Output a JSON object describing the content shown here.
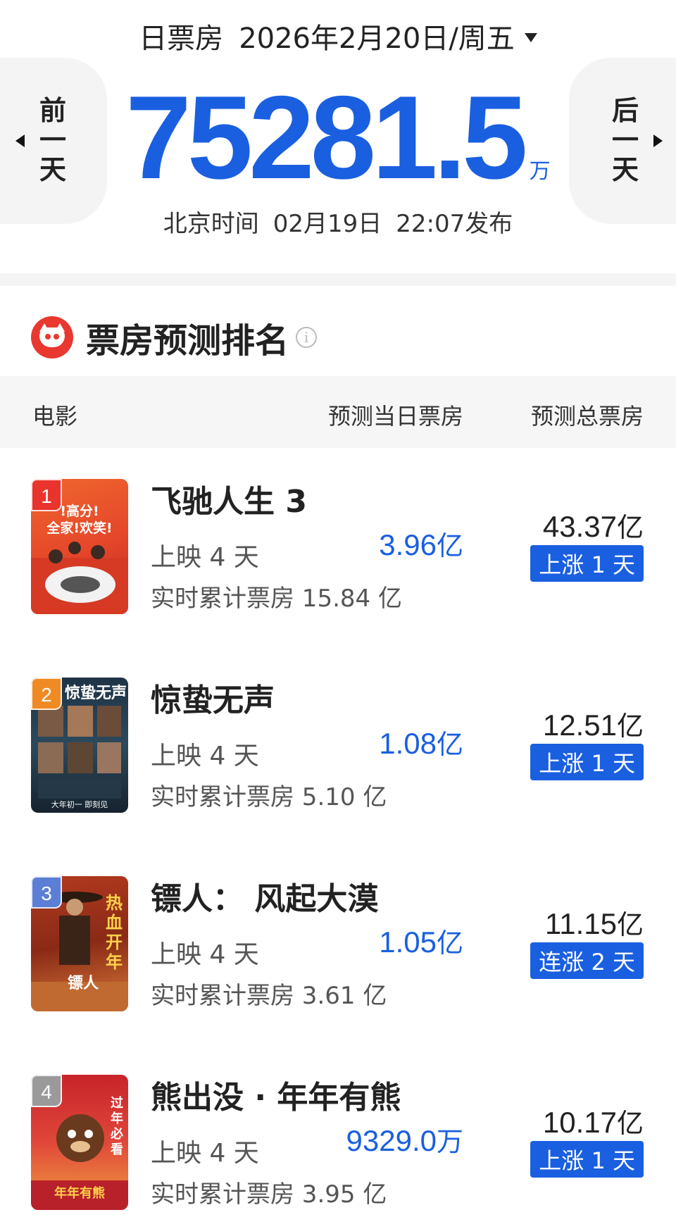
{
  "header": {
    "label": "日票房",
    "date": "2026年2月20日/周五",
    "prev_chars": [
      "前",
      "一",
      "天"
    ],
    "next_chars": [
      "后",
      "一",
      "天"
    ],
    "total": "75281.5",
    "total_unit": "万",
    "publish_prefix": "北京时间",
    "publish_date": "02月19日",
    "publish_time": "22:07发布"
  },
  "section": {
    "title": "票房预测排名",
    "info_glyph": "i"
  },
  "columns": {
    "movie": "电影",
    "day_pred": "预测当日票房",
    "total_pred": "预测总票房"
  },
  "colors": {
    "accent": "#1a5fe0",
    "logo_red": "#e8382f",
    "rank1": "#e8342c",
    "rank2": "#f08a24",
    "rank3": "#5b7fd6",
    "rank4": "#9a9a9a"
  },
  "movies": [
    {
      "rank": "1",
      "title": "飞驰人生 3",
      "days": "上映 4 天",
      "cumulative": "实时累计票房 15.84 亿",
      "day_value": "3.96",
      "day_unit": "亿",
      "total_value": "43.37",
      "total_unit": "亿",
      "trend": "上涨 1 天",
      "poster_text_1": "全家!欢笑!",
      "poster_text_2": "!高分!"
    },
    {
      "rank": "2",
      "title": "惊蛰无声",
      "days": "上映 4 天",
      "cumulative": "实时累计票房 5.10 亿",
      "day_value": "1.08",
      "day_unit": "亿",
      "total_value": "12.51",
      "total_unit": "亿",
      "trend": "上涨 1 天",
      "poster_text_1": "惊蛰无声",
      "poster_text_2": "大年初一 即刻见"
    },
    {
      "rank": "3",
      "title": "镖人：  风起大漠",
      "days": "上映 4 天",
      "cumulative": "实时累计票房 3.61 亿",
      "day_value": "1.05",
      "day_unit": "亿",
      "total_value": "11.15",
      "total_unit": "亿",
      "trend": "连涨 2 天",
      "poster_text_1": "热血开年",
      "poster_text_2": "镖人"
    },
    {
      "rank": "4",
      "title": "熊出没 · 年年有熊",
      "days": "上映 4 天",
      "cumulative": "实时累计票房 3.95 亿",
      "day_value": "9329.0",
      "day_unit": "万",
      "total_value": "10.17",
      "total_unit": "亿",
      "trend": "上涨 1 天",
      "poster_text_1": "过年 必看",
      "poster_text_2": "年年有熊"
    }
  ]
}
